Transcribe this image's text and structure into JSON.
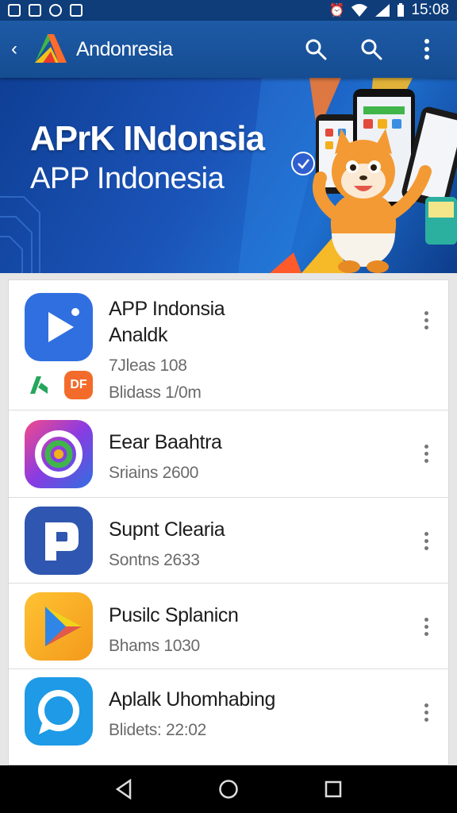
{
  "status_bar": {
    "time": "15:08"
  },
  "app_bar": {
    "title": "Andonresia"
  },
  "banner": {
    "title": "APrK INdonsia",
    "subtitle": "APP Indonesia"
  },
  "apps": [
    {
      "title": "APP Indonsia",
      "subtitle": "Analdk",
      "meta1": "7Jleas 108",
      "meta2": "Blidass 1/0m"
    },
    {
      "title": "Eear Baahtra",
      "meta1": "Sriains 2600"
    },
    {
      "title": "Supnt Clearia",
      "meta1": "Sontns 2633"
    },
    {
      "title": "Pusilc Splanicn",
      "meta1": "Bhams 1030"
    },
    {
      "title": "Aplalk Uhomhabing",
      "meta1": "Blidets: 22:02"
    }
  ],
  "mini_badges": {
    "second": "DF"
  },
  "colors": {
    "app_bar": "#1d5aa6",
    "banner": "#1b54b8",
    "accent": "#2f6fdf"
  }
}
